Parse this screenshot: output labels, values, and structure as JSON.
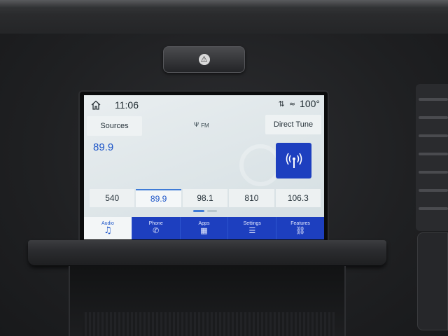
{
  "status_bar": {
    "time": "11:06",
    "temperature": "100°",
    "home_icon": "home-icon",
    "signal_icon": "signal-arrows-icon",
    "wifi_icon": "wifi-icon"
  },
  "audio": {
    "sources_label": "Sources",
    "band": "FM",
    "band_icon": "radio-antenna-icon",
    "direct_tune_label": "Direct Tune",
    "current_frequency": "89.9",
    "tower_icon": "radio-tower-icon"
  },
  "presets": [
    "540",
    "89.9",
    "98.1",
    "810",
    "106.3"
  ],
  "active_preset_index": 1,
  "nav": {
    "items": [
      {
        "label": "Audio",
        "icon": "music-note-icon"
      },
      {
        "label": "Phone",
        "icon": "phone-icon"
      },
      {
        "label": "Apps",
        "icon": "apps-grid-icon"
      },
      {
        "label": "Settings",
        "icon": "sliders-icon"
      },
      {
        "label": "Features",
        "icon": "truck-icon"
      }
    ],
    "active_index": 0
  },
  "colors": {
    "accent_blue": "#1d3fbf",
    "frequency_text": "#1d55c8",
    "screen_background": "#e4eaec"
  }
}
